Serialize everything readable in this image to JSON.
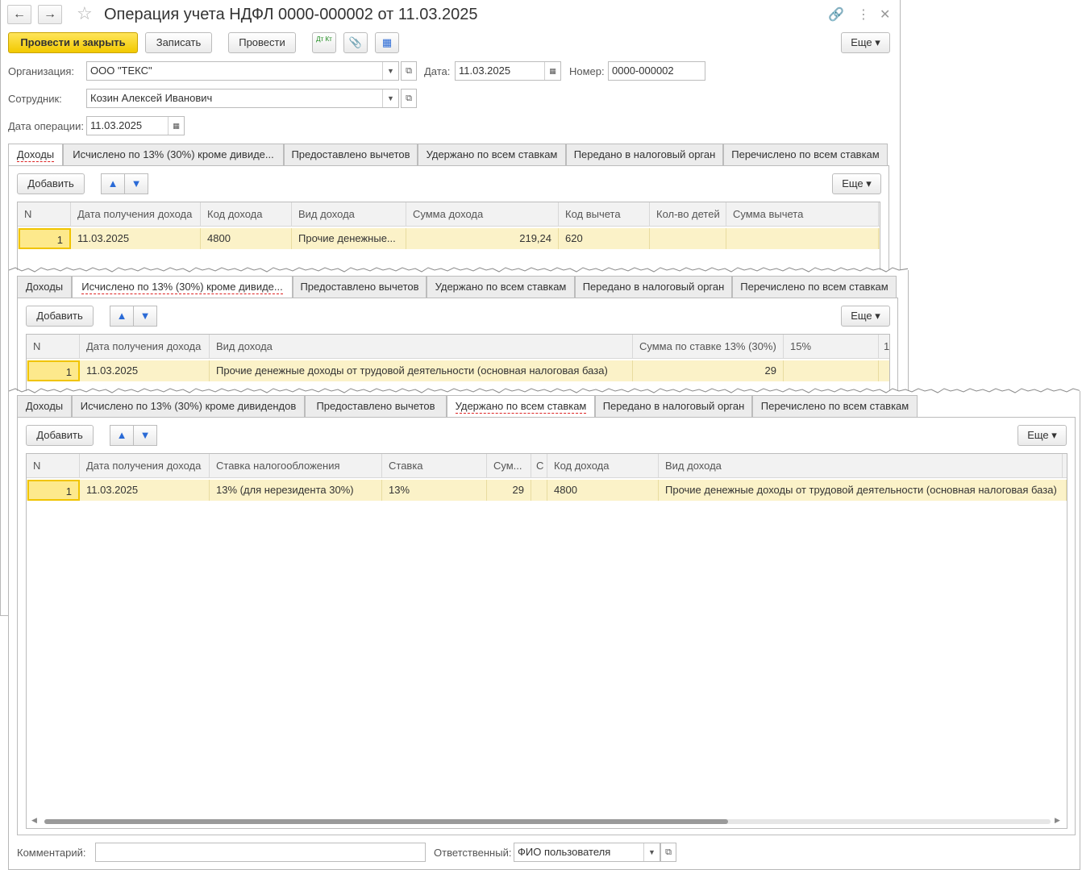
{
  "title": "Операция учета НДФЛ 0000-000002 от 11.03.2025",
  "toolbar": {
    "post_close": "Провести и закрыть",
    "save": "Записать",
    "post": "Провести",
    "dtkt": "Дт Кт",
    "more": "Еще"
  },
  "form": {
    "org_label": "Организация:",
    "org_value": "ООО \"ТЕКС\"",
    "date_label": "Дата:",
    "date_value": "11.03.2025",
    "number_label": "Номер:",
    "number_value": "0000-000002",
    "employee_label": "Сотрудник:",
    "employee_value": "Козин Алексей Иванович",
    "opdate_label": "Дата операции:",
    "opdate_value": "11.03.2025"
  },
  "tabs": {
    "incomes": "Доходы",
    "calc_short": "Исчислено по 13% (30%) кроме дивиде...",
    "calc_full": "Исчислено по 13% (30%) кроме дивидендов",
    "deductions": "Предоставлено вычетов",
    "withheld": "Удержано по всем ставкам",
    "transferred": "Передано в налоговый орган",
    "paid": "Перечислено по всем ставкам"
  },
  "common": {
    "add": "Добавить",
    "more": "Еще",
    "up_icon": "▲",
    "down_icon": "▼"
  },
  "grid1": {
    "headers": [
      "N",
      "Дата получения дохода",
      "Код дохода",
      "Вид дохода",
      "Сумма дохода",
      "Код вычета",
      "Кол-во детей",
      "Сумма вычета"
    ],
    "row": [
      "1",
      "11.03.2025",
      "4800",
      "Прочие денежные...",
      "219,24",
      "620",
      "",
      ""
    ]
  },
  "grid2": {
    "headers": [
      "N",
      "Дата получения дохода",
      "Вид дохода",
      "Сумма по ставке 13% (30%)",
      "15%",
      "1"
    ],
    "row": [
      "1",
      "11.03.2025",
      "Прочие денежные доходы от трудовой деятельности (основная налоговая база)",
      "29",
      "",
      ""
    ]
  },
  "grid3": {
    "headers": [
      "N",
      "Дата получения дохода",
      "Ставка налогообложения",
      "Ставка",
      "Сум...",
      "С",
      "Код дохода",
      "Вид дохода"
    ],
    "row": [
      "1",
      "11.03.2025",
      "13% (для нерезидента 30%)",
      "13%",
      "29",
      "",
      "4800",
      "Прочие денежные доходы от трудовой деятельности (основная налоговая база)"
    ]
  },
  "footer": {
    "comment_label": "Комментарий:",
    "comment_value": "",
    "responsible_label": "Ответственный:",
    "responsible_value": "ФИО пользователя"
  }
}
